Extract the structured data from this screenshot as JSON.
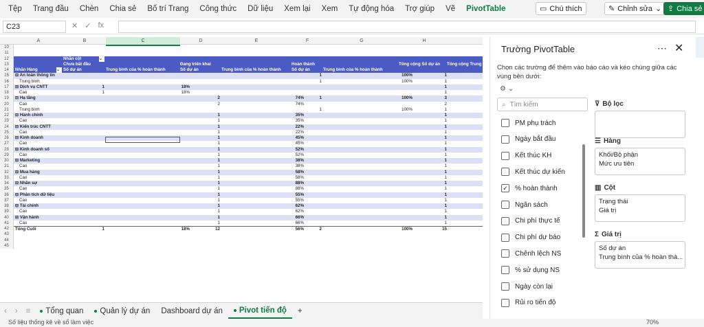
{
  "ribbon": {
    "tabs": [
      "Tệp",
      "Trang đầu",
      "Chèn",
      "Chia sẻ",
      "Bố trí Trang",
      "Công thức",
      "Dữ liệu",
      "Xem lại",
      "Xem",
      "Tự động hóa",
      "Trợ giúp",
      "Vẽ",
      "PivotTable"
    ],
    "comment_label": "Chú thích",
    "edit_label": "Chỉnh sửa",
    "share_label": "Chia sẻ"
  },
  "formula": {
    "namebox": "C23",
    "fx": "fx"
  },
  "grid": {
    "columns": [
      "A",
      "B",
      "C",
      "D",
      "E",
      "F",
      "G",
      "H"
    ],
    "header_rows": {
      "r12_b": "Nhãn cột",
      "r13_b": "Chưa bắt đầu",
      "r13_d": "Đang triển khai",
      "r13_f": "Hoàn thành",
      "r13_h": "Tổng cộng Số dự án",
      "r13_i": "Tổng cộng Trung",
      "r14_a": "Nhãn Hàng",
      "r14_b": "Số dự án",
      "r14_c": "Trung bình của % hoàn thành",
      "r14_d": "Số dự án",
      "r14_e": "Trung bình của % hoàn thành",
      "r14_f": "Số dự án",
      "r14_g": "Trung bình của % hoàn thành"
    },
    "rows": [
      {
        "n": "15",
        "t": "grp",
        "a": "⊟ An toàn thông tin",
        "b": "",
        "c": "",
        "d": "",
        "e": "",
        "f": "1",
        "g": "100%",
        "h": "1"
      },
      {
        "n": "16",
        "t": "alt",
        "a": "Trung bình",
        "b": "",
        "c": "",
        "d": "",
        "e": "",
        "f": "1",
        "g": "100%",
        "h": "1"
      },
      {
        "n": "17",
        "t": "grp",
        "a": "⊟ Dịch vụ CNTT",
        "b": "1",
        "c": "18%",
        "d": "",
        "e": "",
        "f": "",
        "g": "",
        "h": "1"
      },
      {
        "n": "18",
        "t": "alt",
        "a": "Cao",
        "b": "1",
        "c": "18%",
        "d": "",
        "e": "",
        "f": "",
        "g": "",
        "h": "1"
      },
      {
        "n": "19",
        "t": "grp",
        "a": "⊟ Hạ tầng",
        "b": "",
        "c": "",
        "d": "2",
        "e": "74%",
        "f": "1",
        "g": "100%",
        "h": "3"
      },
      {
        "n": "20",
        "t": "alt",
        "a": "Cao",
        "b": "",
        "c": "",
        "d": "2",
        "e": "74%",
        "f": "",
        "g": "",
        "h": "2"
      },
      {
        "n": "21",
        "t": "alt",
        "a": "Trung bình",
        "b": "",
        "c": "",
        "d": "",
        "e": "",
        "f": "1",
        "g": "100%",
        "h": "1"
      },
      {
        "n": "22",
        "t": "grp",
        "a": "⊟ Hành chính",
        "b": "",
        "c": "",
        "d": "1",
        "e": "35%",
        "f": "",
        "g": "",
        "h": "1"
      },
      {
        "n": "23",
        "t": "alt",
        "a": "Cao",
        "b": "",
        "c": "",
        "d": "1",
        "e": "35%",
        "f": "",
        "g": "",
        "h": "1"
      },
      {
        "n": "24",
        "t": "grp",
        "a": "⊟ Kiến trúc CNTT",
        "b": "",
        "c": "",
        "d": "1",
        "e": "22%",
        "f": "",
        "g": "",
        "h": "1"
      },
      {
        "n": "25",
        "t": "alt",
        "a": "Cao",
        "b": "",
        "c": "",
        "d": "1",
        "e": "22%",
        "f": "",
        "g": "",
        "h": "1"
      },
      {
        "n": "26",
        "t": "grp",
        "a": "⊟ Kinh doanh",
        "b": "",
        "c": "",
        "d": "1",
        "e": "45%",
        "f": "",
        "g": "",
        "h": "1"
      },
      {
        "n": "27",
        "t": "alt",
        "a": "Cao",
        "b": "",
        "c": "",
        "d": "1",
        "e": "45%",
        "f": "",
        "g": "",
        "h": "1"
      },
      {
        "n": "28",
        "t": "grp",
        "a": "⊟ Kinh doanh số",
        "b": "",
        "c": "",
        "d": "1",
        "e": "52%",
        "f": "",
        "g": "",
        "h": "1"
      },
      {
        "n": "29",
        "t": "alt",
        "a": "Cao",
        "b": "",
        "c": "",
        "d": "1",
        "e": "52%",
        "f": "",
        "g": "",
        "h": "1"
      },
      {
        "n": "30",
        "t": "grp",
        "a": "⊟ Marketing",
        "b": "",
        "c": "",
        "d": "1",
        "e": "38%",
        "f": "",
        "g": "",
        "h": "1"
      },
      {
        "n": "31",
        "t": "alt",
        "a": "Cao",
        "b": "",
        "c": "",
        "d": "1",
        "e": "38%",
        "f": "",
        "g": "",
        "h": "1"
      },
      {
        "n": "32",
        "t": "grp",
        "a": "⊟ Mua hàng",
        "b": "",
        "c": "",
        "d": "1",
        "e": "58%",
        "f": "",
        "g": "",
        "h": "1"
      },
      {
        "n": "33",
        "t": "alt",
        "a": "Cao",
        "b": "",
        "c": "",
        "d": "1",
        "e": "58%",
        "f": "",
        "g": "",
        "h": "1"
      },
      {
        "n": "34",
        "t": "grp",
        "a": "⊟ Nhân sự",
        "b": "",
        "c": "",
        "d": "1",
        "e": "88%",
        "f": "",
        "g": "",
        "h": "1"
      },
      {
        "n": "35",
        "t": "alt",
        "a": "Cao",
        "b": "",
        "c": "",
        "d": "1",
        "e": "88%",
        "f": "",
        "g": "",
        "h": "1"
      },
      {
        "n": "36",
        "t": "grp",
        "a": "⊟ Phân tích dữ liệu",
        "b": "",
        "c": "",
        "d": "1",
        "e": "55%",
        "f": "",
        "g": "",
        "h": "1"
      },
      {
        "n": "37",
        "t": "alt",
        "a": "Cao",
        "b": "",
        "c": "",
        "d": "1",
        "e": "55%",
        "f": "",
        "g": "",
        "h": "1"
      },
      {
        "n": "38",
        "t": "grp",
        "a": "⊟ Tài chính",
        "b": "",
        "c": "",
        "d": "1",
        "e": "62%",
        "f": "",
        "g": "",
        "h": "1"
      },
      {
        "n": "39",
        "t": "alt",
        "a": "Cao",
        "b": "",
        "c": "",
        "d": "1",
        "e": "62%",
        "f": "",
        "g": "",
        "h": "1"
      },
      {
        "n": "40",
        "t": "grp",
        "a": "⊟ Vận hành",
        "b": "",
        "c": "",
        "d": "1",
        "e": "66%",
        "f": "",
        "g": "",
        "h": "1"
      },
      {
        "n": "41",
        "t": "alt",
        "a": "Cao",
        "b": "",
        "c": "",
        "d": "1",
        "e": "66%",
        "f": "",
        "g": "",
        "h": "1"
      },
      {
        "n": "42",
        "t": "tot",
        "a": "Tổng Cuối",
        "b": "1",
        "c": "18%",
        "d": "12",
        "e": "56%",
        "f": "2",
        "g": "100%",
        "h": "15"
      }
    ],
    "extra_rows": [
      "10",
      "11",
      "12",
      "13",
      "14",
      "43",
      "44",
      "45"
    ]
  },
  "sheets": {
    "tabs": [
      "Tổng quan",
      "Quản lý dự án",
      "Dashboard dự án",
      "Pivot tiến độ"
    ],
    "active": "Pivot tiến độ",
    "add": "+"
  },
  "status": {
    "text": "Số liệu thống kê về sổ làm việc",
    "zoom": "70%"
  },
  "panel": {
    "title": "Trường PivotTable",
    "desc": "Chọn các trường để thêm vào báo cáo và kéo chúng giữa các vùng bên dưới:",
    "search_placeholder": "Tìm kiếm",
    "fields": [
      {
        "label": "PM phụ trách",
        "checked": false
      },
      {
        "label": "Ngày bắt đầu",
        "checked": false
      },
      {
        "label": "Kết thúc KH",
        "checked": false
      },
      {
        "label": "Kết thúc dự kiến",
        "checked": false
      },
      {
        "label": "% hoàn thành",
        "checked": true
      },
      {
        "label": "Ngân sách",
        "checked": false
      },
      {
        "label": "Chi phí thực tế",
        "checked": false
      },
      {
        "label": "Chi phí dự báo",
        "checked": false
      },
      {
        "label": "Chênh lệch NS",
        "checked": false
      },
      {
        "label": "% sử dụng NS",
        "checked": false
      },
      {
        "label": "Ngày còn lại",
        "checked": false
      },
      {
        "label": "Rủi ro tiến độ",
        "checked": false
      }
    ],
    "areas": {
      "filter": {
        "label": "Bộ lọc",
        "items": []
      },
      "rows": {
        "label": "Hàng",
        "items": [
          "Khối/Bộ phận",
          "Mức ưu tiên"
        ]
      },
      "cols": {
        "label": "Cột",
        "items": [
          "Trạng thái",
          "Giá trị"
        ]
      },
      "values": {
        "label": "Giá trị",
        "items": [
          "Số dự án",
          "Trung bình của % hoàn thà..."
        ]
      }
    }
  }
}
